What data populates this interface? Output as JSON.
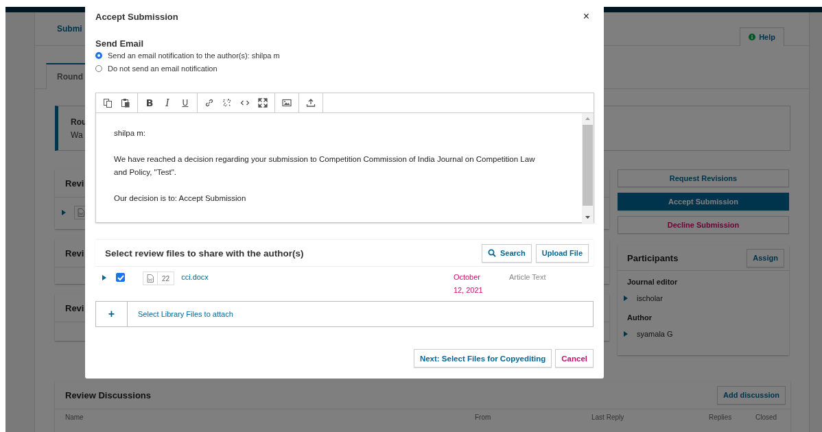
{
  "page": {
    "header_title": "Submi",
    "help_button": "Help",
    "tab": {
      "label": "Round",
      "selected": true
    },
    "notice": {
      "title": "Rou",
      "text": "Wa"
    },
    "sections": [
      {
        "title": "Revi",
        "file_row": true
      },
      {
        "title": "Revi",
        "file_row": false
      },
      {
        "title": "Revi",
        "file_row": false
      }
    ],
    "decision_buttons": [
      {
        "label": "Request Revisions",
        "kind": "default"
      },
      {
        "label": "Accept Submission",
        "kind": "primary"
      },
      {
        "label": "Decline Submission",
        "kind": "negative"
      }
    ],
    "participants": {
      "title": "Participants",
      "assign_button": "Assign",
      "groups": [
        {
          "role": "Journal editor",
          "members": [
            "ischolar"
          ]
        },
        {
          "role": "Author",
          "members": [
            "syamala G"
          ]
        }
      ]
    },
    "discussions": {
      "title": "Review Discussions",
      "add_button": "Add discussion",
      "columns": [
        "Name",
        "From",
        "Last Reply",
        "Replies",
        "Closed"
      ]
    }
  },
  "modal": {
    "title": "Accept Submission",
    "close": "×",
    "send_email": {
      "heading": "Send Email",
      "options": [
        {
          "label": "Send an email notification to the author(s): shilpa m",
          "selected": true
        },
        {
          "label": "Do not send an email notification",
          "selected": false
        }
      ]
    },
    "editor": {
      "toolbar": [
        [
          {
            "kind": "copy"
          },
          {
            "kind": "paste"
          }
        ],
        [
          {
            "kind": "bold",
            "glyph": "B"
          },
          {
            "kind": "italic",
            "glyph": "I"
          },
          {
            "kind": "underline",
            "glyph": "U"
          }
        ],
        [
          {
            "kind": "link"
          },
          {
            "kind": "unlink"
          },
          {
            "kind": "code"
          },
          {
            "kind": "fullscreen"
          }
        ],
        [
          {
            "kind": "image"
          }
        ],
        [
          {
            "kind": "upload"
          }
        ]
      ],
      "paragraphs": [
        "shilpa m:",
        "We have reached a decision regarding your submission to Competition Commission of India Journal on Competition Law and Policy, \"Test\".",
        "Our decision is to: Accept Submission"
      ]
    },
    "files": {
      "title": "Select review files to share with the author(s)",
      "buttons": [
        {
          "label": "Search",
          "kind": "search"
        },
        {
          "label": "Upload File",
          "kind": "upload"
        }
      ],
      "rows": [
        {
          "checked": true,
          "file_id": "22",
          "name": "cci.docx",
          "date": "October 12, 2021",
          "type": "Article Text"
        }
      ],
      "library": {
        "icon": "+",
        "label": "Select Library Files to attach"
      }
    },
    "footer_buttons": [
      {
        "label": "Next: Select Files for Copyediting",
        "kind": "primary"
      },
      {
        "label": "Cancel",
        "kind": "cancel"
      }
    ]
  }
}
